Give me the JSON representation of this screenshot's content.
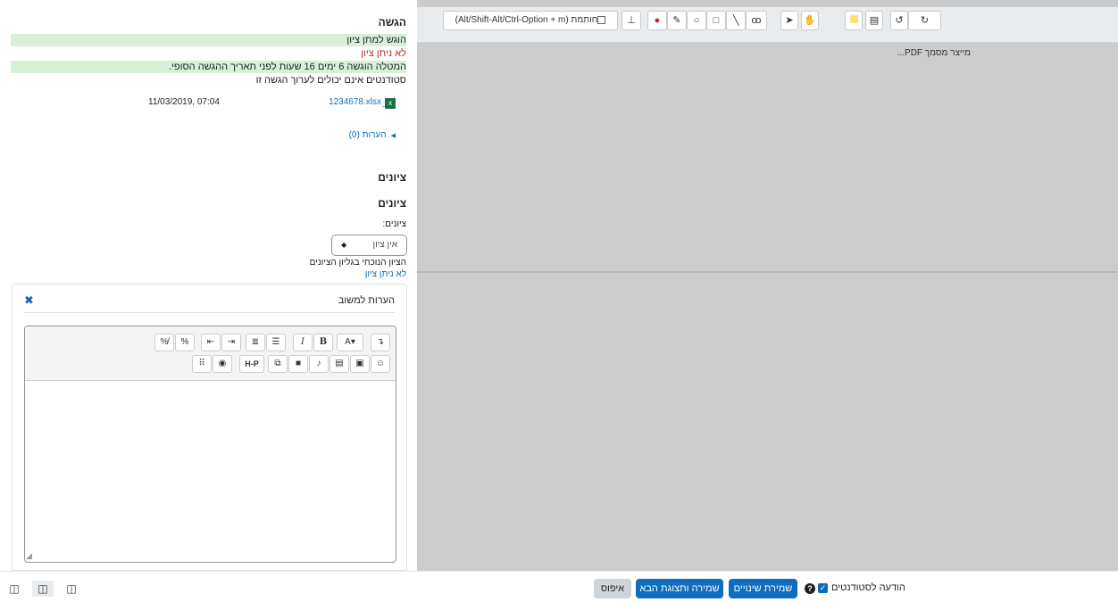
{
  "submission": {
    "title": "הגשה",
    "status_graded": "הוגש למתן ציון",
    "status_not_graded": "לא ניתן ציון",
    "time_remaining": "המטלה הוגשה 6 ימים 16 שעות לפני תאריך ההגשה הסופי.",
    "edit_note": "סטודנטים אינם יכולים לערוך הגשה זו",
    "file_name": "1234678.xlsx",
    "file_date": "11/03/2019, 07:04",
    "comments_link": "הערות (0)"
  },
  "grades": {
    "section_title": "ציונים",
    "sub_title": "ציונים",
    "label": "ציונים:",
    "select_value": "אין ציון",
    "current_label": "הציון הנוכחי בגליון הציונים",
    "current_value": "לא ניתן ציון"
  },
  "feedback": {
    "title": "הערות למשוב"
  },
  "annotator": {
    "stamp_label": "חותמת (Alt/Shift-Alt/Ctrl-Option + m)",
    "pdf_message": "מייצר מסמך PDF..."
  },
  "footer": {
    "notify_label": "הודעה לסטודנטים",
    "save_button": "שמירת שינויים",
    "save_next_button": "שמירה ותצוגת הבא",
    "reset_button": "איפוס"
  },
  "colors": {
    "green_bar": "#d7f1d9",
    "red_text": "#c0272d",
    "primary": "#0f6cbf"
  }
}
